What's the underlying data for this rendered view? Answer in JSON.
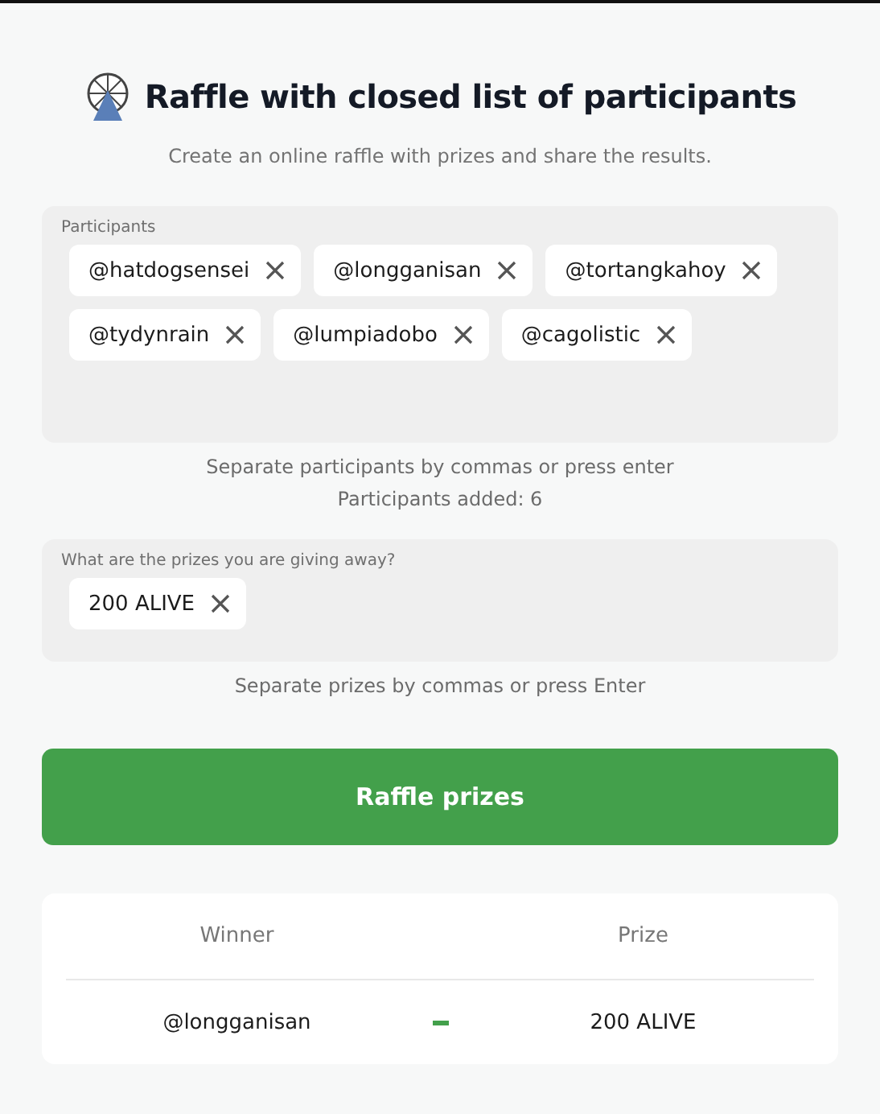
{
  "header": {
    "title": "Raffle with closed list of participants",
    "subtitle": "Create an online raffle with prizes and share the results."
  },
  "participants": {
    "label": "Participants",
    "tags": [
      {
        "text": "@hatdogsensei"
      },
      {
        "text": "@longganisan"
      },
      {
        "text": "@tortangkahoy"
      },
      {
        "text": "@tydynrain"
      },
      {
        "text": "@lumpiadobo"
      },
      {
        "text": "@cagolistic"
      }
    ],
    "hint": "Separate participants by commas or press enter",
    "count": "Participants added: 6"
  },
  "prizes": {
    "label": "What are the prizes you are giving away?",
    "tags": [
      {
        "text": "200 ALIVE"
      }
    ],
    "hint": "Separate prizes by commas or press Enter"
  },
  "button": "Raffle prizes",
  "results": {
    "columns": [
      "Winner",
      "Prize"
    ],
    "rows": [
      {
        "winner": "@longganisan",
        "prize": "200 ALIVE"
      }
    ]
  }
}
